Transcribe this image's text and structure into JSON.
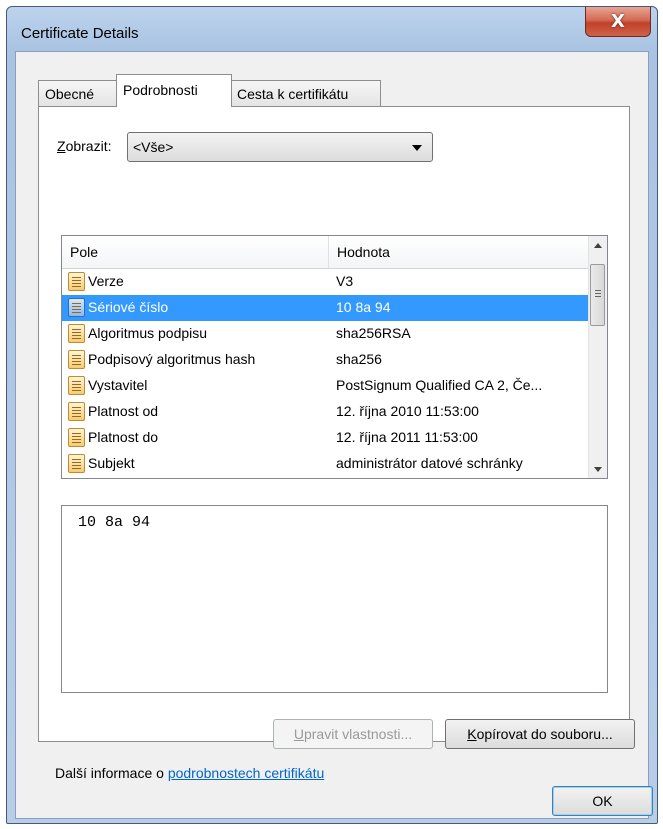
{
  "window": {
    "title": "Certificate Details",
    "close_glyph": "X"
  },
  "tabs": [
    {
      "label": "Obecné"
    },
    {
      "label": "Podrobnosti"
    },
    {
      "label": "Cesta k certifikátu"
    }
  ],
  "show": {
    "label_accel": "Z",
    "label_rest": "obrazit:",
    "value": "<Vše>"
  },
  "list": {
    "columns": {
      "field": "Pole",
      "value": "Hodnota"
    },
    "rows": [
      {
        "field": "Verze",
        "value": "V3"
      },
      {
        "field": "Sériové číslo",
        "value": "10 8a 94",
        "selected": true
      },
      {
        "field": "Algoritmus podpisu",
        "value": "sha256RSA"
      },
      {
        "field": "Podpisový algoritmus hash",
        "value": "sha256"
      },
      {
        "field": "Vystavitel",
        "value": "PostSignum Qualified CA 2, Če..."
      },
      {
        "field": "Platnost od",
        "value": "12. října 2010 11:53:00"
      },
      {
        "field": "Platnost do",
        "value": "12. října 2011 11:53:00"
      },
      {
        "field": "Subjekt",
        "value": "administrátor datové schránky"
      }
    ]
  },
  "detail": {
    "text": "10 8a 94"
  },
  "buttons": {
    "edit_accel": "U",
    "edit_rest": "pravit vlastnosti...",
    "copy_accel": "K",
    "copy_rest": "opírovat do souboru...",
    "ok": "OK"
  },
  "more_info": {
    "prefix": "Další informace o ",
    "link": "podrobnostech certifikátu"
  }
}
